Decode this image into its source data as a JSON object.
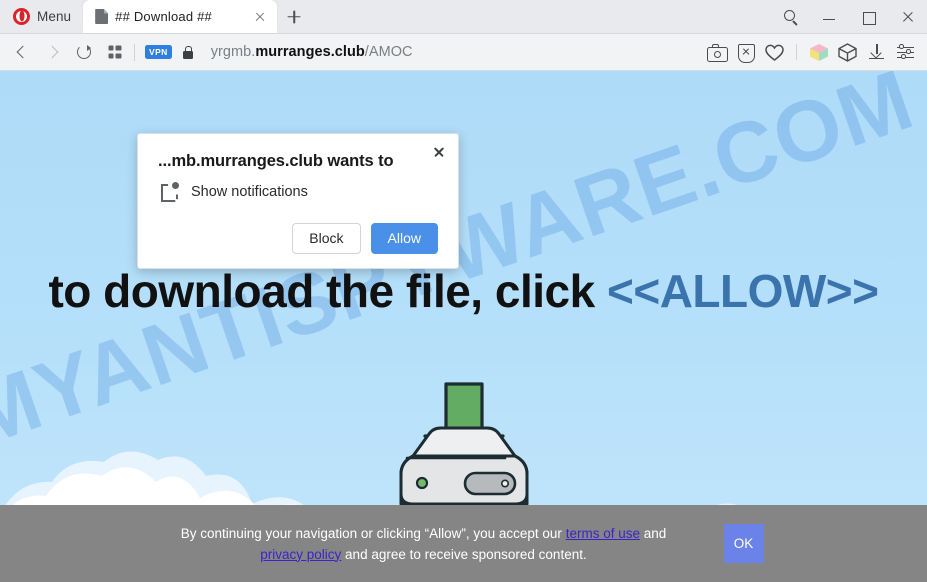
{
  "browser": {
    "menu_label": "Menu",
    "tab": {
      "title": "## Download ##",
      "favicon": "document-icon",
      "close": "close-icon"
    },
    "new_tab": "new-tab-icon",
    "window_controls": [
      "search-icon",
      "minimize-icon",
      "maximize-icon",
      "close-icon"
    ],
    "nav": {
      "back": "back-arrow-icon",
      "forward": "forward-arrow-icon",
      "reload": "reload-icon",
      "tabs_overview": "grid-icon",
      "vpn_badge": "VPN",
      "lock": "lock-icon",
      "url_prefix": "yrgmb.",
      "url_host": "murranges.club",
      "url_path": "/AMOC"
    },
    "toolbar_icons": [
      "snapshot-camera-icon",
      "ad-blocker-shield-icon",
      "heart-icon",
      "extensions-cube-icon",
      "package-box-icon",
      "downloads-icon",
      "easy-setup-sliders-icon"
    ]
  },
  "dialog": {
    "title": "...mb.murranges.club wants to",
    "permission_icon": "notifications-icon",
    "permission_label": "Show notifications",
    "block_label": "Block",
    "allow_label": "Allow",
    "close_icon": "close-icon",
    "allow_color": "#4a90e8"
  },
  "page": {
    "watermark": "MYANTISPYWARE.COM",
    "headline_plain": "to download the file, click ",
    "headline_accent": "<<ALLOW>>",
    "headline_accent_color": "#3b74ad",
    "sky_color": "#b3ddf9",
    "illustration": "hard-drive-download-icon",
    "arrow_color": "#5cab5c"
  },
  "consent": {
    "text_part1": "By continuing your navigation or clicking “Allow”, you accept our ",
    "link_terms": "terms of use",
    "text_part2": " and ",
    "link_privacy": "privacy policy",
    "text_part3": " and agree to receive sponsored content.",
    "ok_label": "OK",
    "bg_color": "#858585",
    "ok_color": "#6b83e8"
  }
}
